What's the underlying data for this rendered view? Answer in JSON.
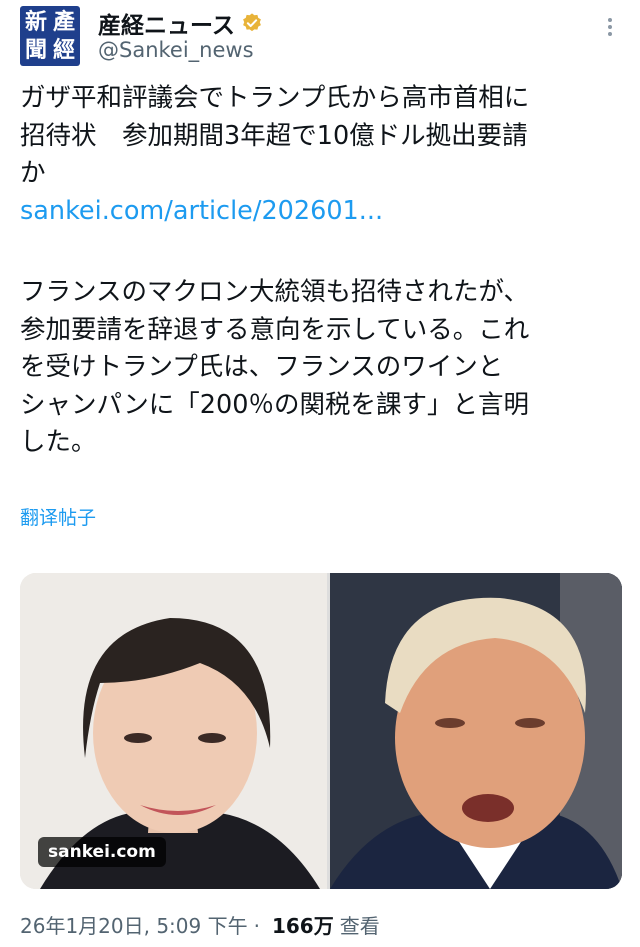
{
  "account": {
    "avatar_chars": [
      "新",
      "產",
      "聞",
      "經"
    ],
    "display_name": "産経ニュース",
    "handle": "@Sankei_news",
    "verified": true,
    "avatar_color": "#1f3f8c"
  },
  "post": {
    "lines1": [
      "ガザ平和評議会でトランプ氏から高市首相に",
      "招待状　参加期間3年超で10億ドル拠出要請",
      "か"
    ],
    "link": "sankei.com/article/202601...",
    "lines2": [
      "フランスのマクロン大統領も招待されたが、",
      "参加要請を辞退する意向を示している。これ",
      "を受けトランプ氏は、フランスのワインと",
      "シャンパンに「200％の関税を課す」と言明",
      "した。"
    ]
  },
  "translate_label": "翻译帖子",
  "media": {
    "source_badge": "sankei.com"
  },
  "meta": {
    "timestamp": "26年1月20日, 5:09 下午",
    "separator": "·",
    "views_count": "166万",
    "views_label": "查看"
  },
  "colors": {
    "link": "#1d9bf0",
    "text": "#0f1419",
    "secondary": "#536471",
    "verified_badge": "#e8b339"
  }
}
